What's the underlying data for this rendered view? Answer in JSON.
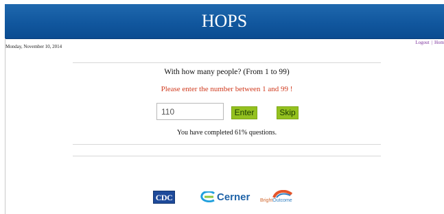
{
  "header": {
    "title": "HOPS"
  },
  "date": "Monday, November 10, 2014",
  "links": {
    "logout": "Logout",
    "separator": "|",
    "home": "Hom"
  },
  "survey": {
    "question": "With how many people? (From 1 to 99)",
    "error": "Please enter the number between 1 and 99 !",
    "answer_value": "110",
    "enter_label": "Enter",
    "skip_label": "Skip",
    "progress_text": "You have completed 61% questions."
  },
  "footer": {
    "cdc_logo": "CDC",
    "cerner_logo": "Cerner",
    "bright_logo_prefix": "Bright",
    "bright_logo_suffix": "Outcome"
  },
  "colors": {
    "header_blue": "#11579e",
    "error_red": "#d03a1e",
    "button_green": "#94c11f",
    "link_purple": "#7a2e9a"
  }
}
